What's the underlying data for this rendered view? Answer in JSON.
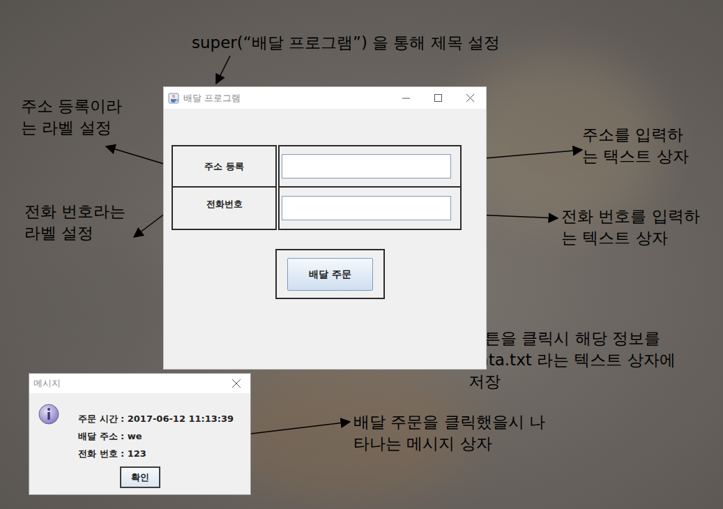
{
  "annotations": [
    {
      "lines": [
        "super(“배달 프로그램”) 을 통해 제목 설정"
      ]
    },
    {
      "lines": [
        "주소 등록이라",
        "는 라벨 설정"
      ]
    },
    {
      "lines": [
        "전화 번호라는",
        "라벨 설정"
      ]
    },
    {
      "lines": [
        "주소를 입력하",
        "는 택스트 상자"
      ]
    },
    {
      "lines": [
        "전화 번호를 입력하",
        "는 텍스트 상자"
      ]
    },
    {
      "lines": [
        "버튼을 클릭시 해당 정보를",
        "data.txt 라는 텍스트 상자에",
        "저장"
      ]
    },
    {
      "lines": [
        "배달 주문을 클릭했을시 나",
        "타나는 메시지 상자"
      ]
    }
  ],
  "window": {
    "title": "배달 프로그램"
  },
  "form": {
    "fields": [
      {
        "label": "주소 등록",
        "value": ""
      },
      {
        "label": "전화번호",
        "value": ""
      }
    ],
    "button": "배달 주문"
  },
  "dialog": {
    "title": "메시지",
    "lines": [
      "주문 시간 : 2017-06-12 11:13:39",
      "배달 주소 : we",
      "전화 번호 : 123"
    ],
    "button": "확인"
  }
}
